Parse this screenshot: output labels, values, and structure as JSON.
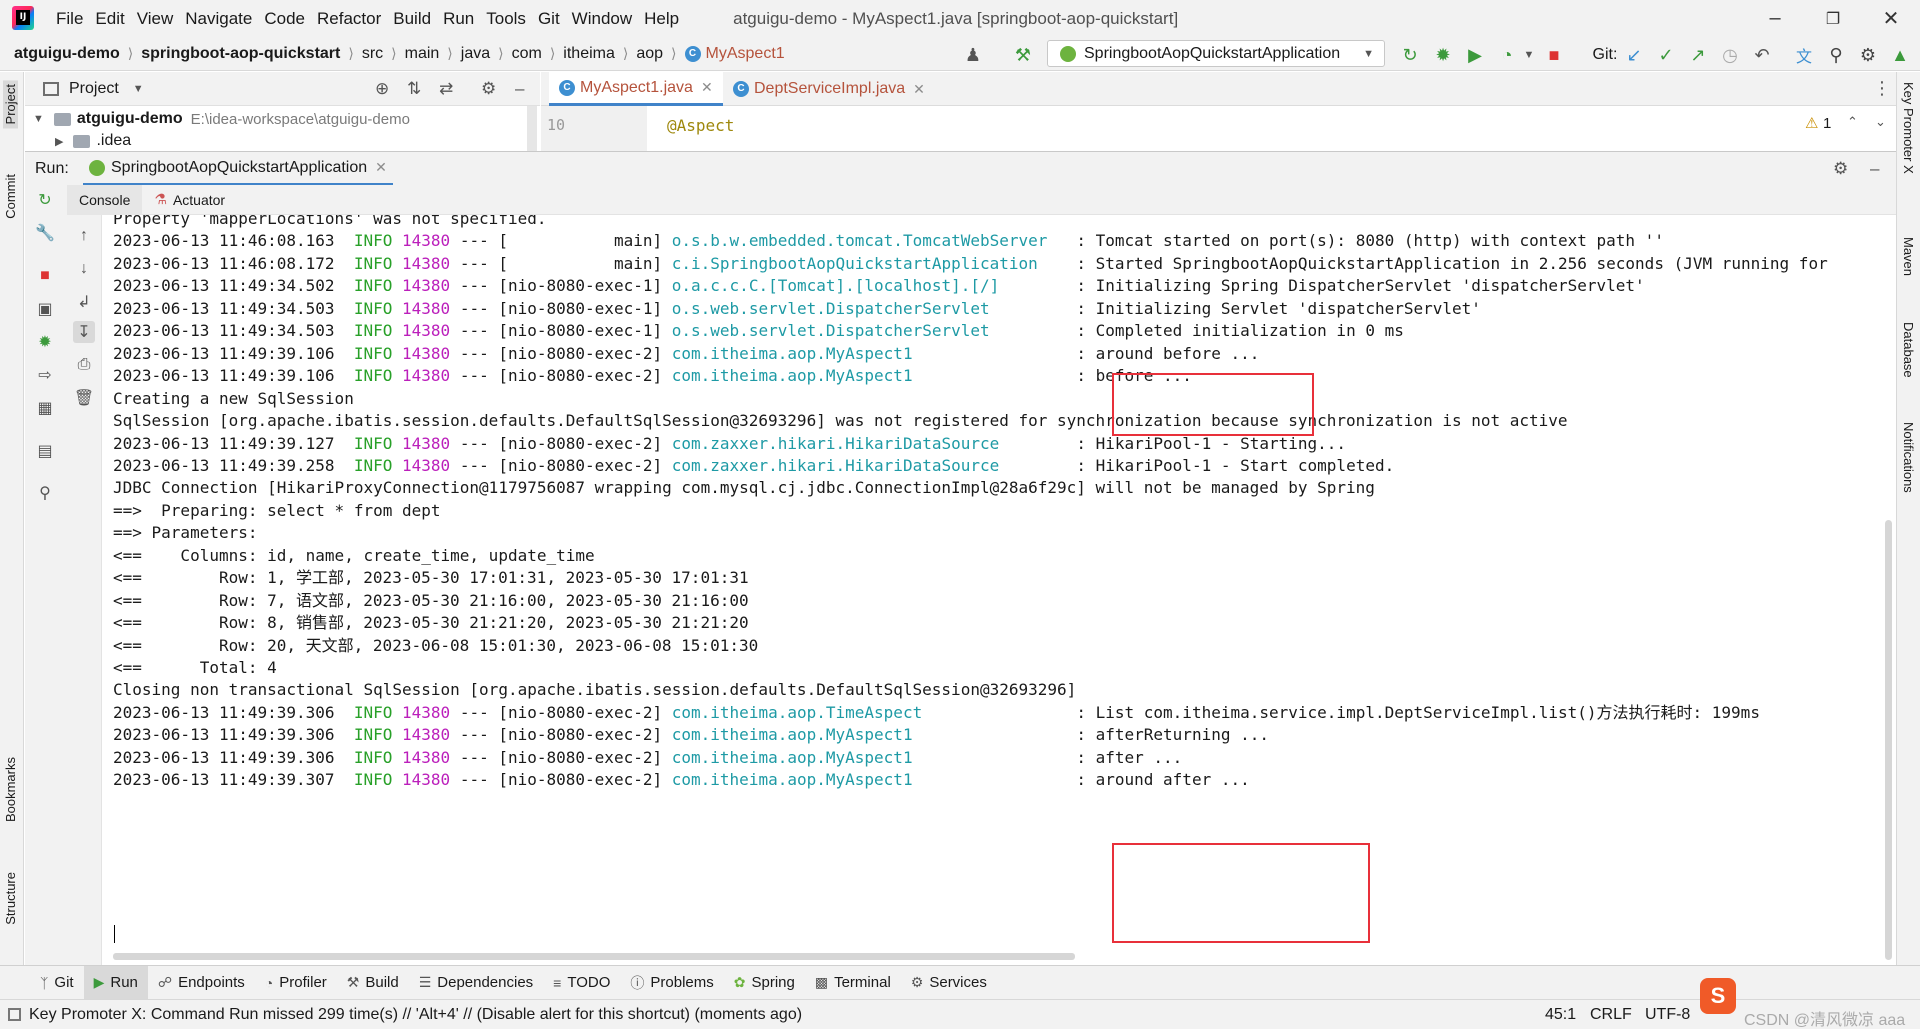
{
  "app": {
    "window_title": "atguigu-demo - MyAspect1.java [springboot-aop-quickstart]",
    "menu": [
      "File",
      "Edit",
      "View",
      "Navigate",
      "Code",
      "Refactor",
      "Build",
      "Run",
      "Tools",
      "Git",
      "Window",
      "Help"
    ]
  },
  "breadcrumb": [
    "atguigu-demo",
    "springboot-aop-quickstart",
    "src",
    "main",
    "java",
    "com",
    "itheima",
    "aop",
    "MyAspect1"
  ],
  "toolbar": {
    "run_config": "SpringbootAopQuickstartApplication",
    "git_label": "Git:"
  },
  "left_strip": {
    "project": "Project",
    "commit": "Commit",
    "bookmarks": "Bookmarks",
    "structure": "Structure"
  },
  "right_strip": {
    "key_promoter": "Key Promoter X",
    "maven": "Maven",
    "database": "Database",
    "notifications": "Notifications"
  },
  "project_panel": {
    "title": "Project",
    "root_name": "atguigu-demo",
    "root_path": "E:\\idea-workspace\\atguigu-demo",
    "child": ".idea"
  },
  "editor": {
    "tabs": [
      {
        "label": "MyAspect1.java",
        "active": true
      },
      {
        "label": "DeptServiceImpl.java",
        "active": false
      }
    ],
    "line_number": "10",
    "code": "@Aspect",
    "warnings": "1"
  },
  "run_panel": {
    "label": "Run:",
    "tab": "SpringbootAopQuickstartApplication",
    "subtabs": [
      "Console",
      "Actuator"
    ]
  },
  "console_lines": [
    {
      "plain": "Property 'mapperLocations' was not specified."
    },
    {
      "ts": "2023-06-13 11:46:08.163",
      "level": "INFO",
      "pid": "14380",
      "thread": "--- [           main]",
      "logger": "o.s.b.w.embedded.tomcat.TomcatWebServer  ",
      "msg": ": Tomcat started on port(s): 8080 (http) with context path ''"
    },
    {
      "ts": "2023-06-13 11:46:08.172",
      "level": "INFO",
      "pid": "14380",
      "thread": "--- [           main]",
      "logger": "c.i.SpringbootAopQuickstartApplication   ",
      "msg": ": Started SpringbootAopQuickstartApplication in 2.256 seconds (JVM running for"
    },
    {
      "ts": "2023-06-13 11:49:34.502",
      "level": "INFO",
      "pid": "14380",
      "thread": "--- [nio-8080-exec-1]",
      "logger": "o.a.c.c.C.[Tomcat].[localhost].[/]       ",
      "msg": ": Initializing Spring DispatcherServlet 'dispatcherServlet'"
    },
    {
      "ts": "2023-06-13 11:49:34.503",
      "level": "INFO",
      "pid": "14380",
      "thread": "--- [nio-8080-exec-1]",
      "logger": "o.s.web.servlet.DispatcherServlet        ",
      "msg": ": Initializing Servlet 'dispatcherServlet'"
    },
    {
      "ts": "2023-06-13 11:49:34.503",
      "level": "INFO",
      "pid": "14380",
      "thread": "--- [nio-8080-exec-1]",
      "logger": "o.s.web.servlet.DispatcherServlet        ",
      "msg": ": Completed initialization in 0 ms"
    },
    {
      "ts": "2023-06-13 11:49:39.106",
      "level": "INFO",
      "pid": "14380",
      "thread": "--- [nio-8080-exec-2]",
      "logger": "com.itheima.aop.MyAspect1                ",
      "msg": ": around before ..."
    },
    {
      "ts": "2023-06-13 11:49:39.106",
      "level": "INFO",
      "pid": "14380",
      "thread": "--- [nio-8080-exec-2]",
      "logger": "com.itheima.aop.MyAspect1                ",
      "msg": ": before ..."
    },
    {
      "plain": "Creating a new SqlSession"
    },
    {
      "plain": "SqlSession [org.apache.ibatis.session.defaults.DefaultSqlSession@32693296] was not registered for synchronization because synchronization is not active"
    },
    {
      "ts": "2023-06-13 11:49:39.127",
      "level": "INFO",
      "pid": "14380",
      "thread": "--- [nio-8080-exec-2]",
      "logger": "com.zaxxer.hikari.HikariDataSource       ",
      "msg": ": HikariPool-1 - Starting..."
    },
    {
      "ts": "2023-06-13 11:49:39.258",
      "level": "INFO",
      "pid": "14380",
      "thread": "--- [nio-8080-exec-2]",
      "logger": "com.zaxxer.hikari.HikariDataSource       ",
      "msg": ": HikariPool-1 - Start completed."
    },
    {
      "plain": "JDBC Connection [HikariProxyConnection@1179756087 wrapping com.mysql.cj.jdbc.ConnectionImpl@28a6f29c] will not be managed by Spring"
    },
    {
      "plain": "==>  Preparing: select * from dept"
    },
    {
      "plain": "==> Parameters: "
    },
    {
      "plain": "<==    Columns: id, name, create_time, update_time"
    },
    {
      "plain": "<==        Row: 1, 学工部, 2023-05-30 17:01:31, 2023-05-30 17:01:31"
    },
    {
      "plain": "<==        Row: 7, 语文部, 2023-05-30 21:16:00, 2023-05-30 21:16:00"
    },
    {
      "plain": "<==        Row: 8, 销售部, 2023-05-30 21:21:20, 2023-05-30 21:21:20"
    },
    {
      "plain": "<==        Row: 20, 天文部, 2023-06-08 15:01:30, 2023-06-08 15:01:30"
    },
    {
      "plain": "<==      Total: 4"
    },
    {
      "plain": "Closing non transactional SqlSession [org.apache.ibatis.session.defaults.DefaultSqlSession@32693296]"
    },
    {
      "ts": "2023-06-13 11:49:39.306",
      "level": "INFO",
      "pid": "14380",
      "thread": "--- [nio-8080-exec-2]",
      "logger": "com.itheima.aop.TimeAspect               ",
      "msg": ": List com.itheima.service.impl.DeptServiceImpl.list()方法执行耗时: 199ms"
    },
    {
      "ts": "2023-06-13 11:49:39.306",
      "level": "INFO",
      "pid": "14380",
      "thread": "--- [nio-8080-exec-2]",
      "logger": "com.itheima.aop.MyAspect1                ",
      "msg": ": afterReturning ..."
    },
    {
      "ts": "2023-06-13 11:49:39.306",
      "level": "INFO",
      "pid": "14380",
      "thread": "--- [nio-8080-exec-2]",
      "logger": "com.itheima.aop.MyAspect1                ",
      "msg": ": after ..."
    },
    {
      "ts": "2023-06-13 11:49:39.307",
      "level": "INFO",
      "pid": "14380",
      "thread": "--- [nio-8080-exec-2]",
      "logger": "com.itheima.aop.MyAspect1                ",
      "msg": ": around after ..."
    }
  ],
  "bottom_tabs": [
    "Git",
    "Run",
    "Endpoints",
    "Profiler",
    "Build",
    "Dependencies",
    "TODO",
    "Problems",
    "Spring",
    "Terminal",
    "Services"
  ],
  "status": {
    "message": "Key Promoter X: Command Run missed 299 time(s) // 'Alt+4' // (Disable alert for this shortcut) (moments ago)",
    "position": "45:1",
    "line_sep": "CRLF",
    "encoding": "UTF-8",
    "watermark": "CSDN @清风微凉 aaa"
  },
  "colors": {
    "highlight_box": "#e8303a",
    "log_level": "#28a028",
    "pid": "#bb1fbb",
    "logger": "#1e9aa5"
  }
}
